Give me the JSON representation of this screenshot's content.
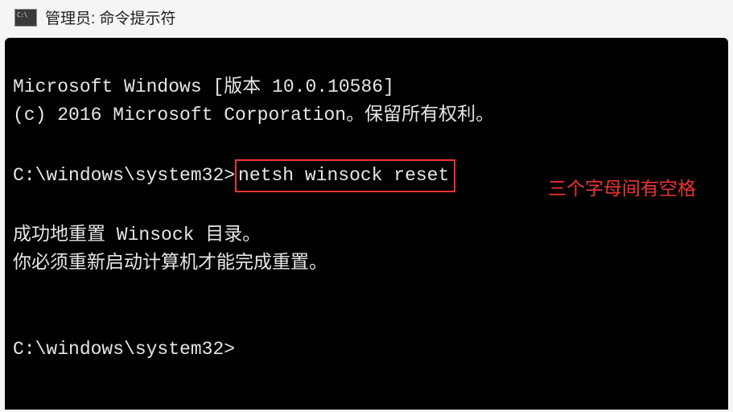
{
  "titlebar": {
    "icon_name": "cmd-icon",
    "title": "管理员: 命令提示符"
  },
  "terminal": {
    "line_version": "Microsoft Windows [版本 10.0.10586]",
    "line_copyright": "(c) 2016 Microsoft Corporation。保留所有权利。",
    "prompt1": "C:\\windows\\system32>",
    "command1": "netsh winsock reset",
    "result1": "成功地重置 Winsock 目录。",
    "result2": "你必须重新启动计算机才能完成重置。",
    "prompt2": "C:\\windows\\system32>"
  },
  "annotation": {
    "note": "三个字母间有空格"
  }
}
